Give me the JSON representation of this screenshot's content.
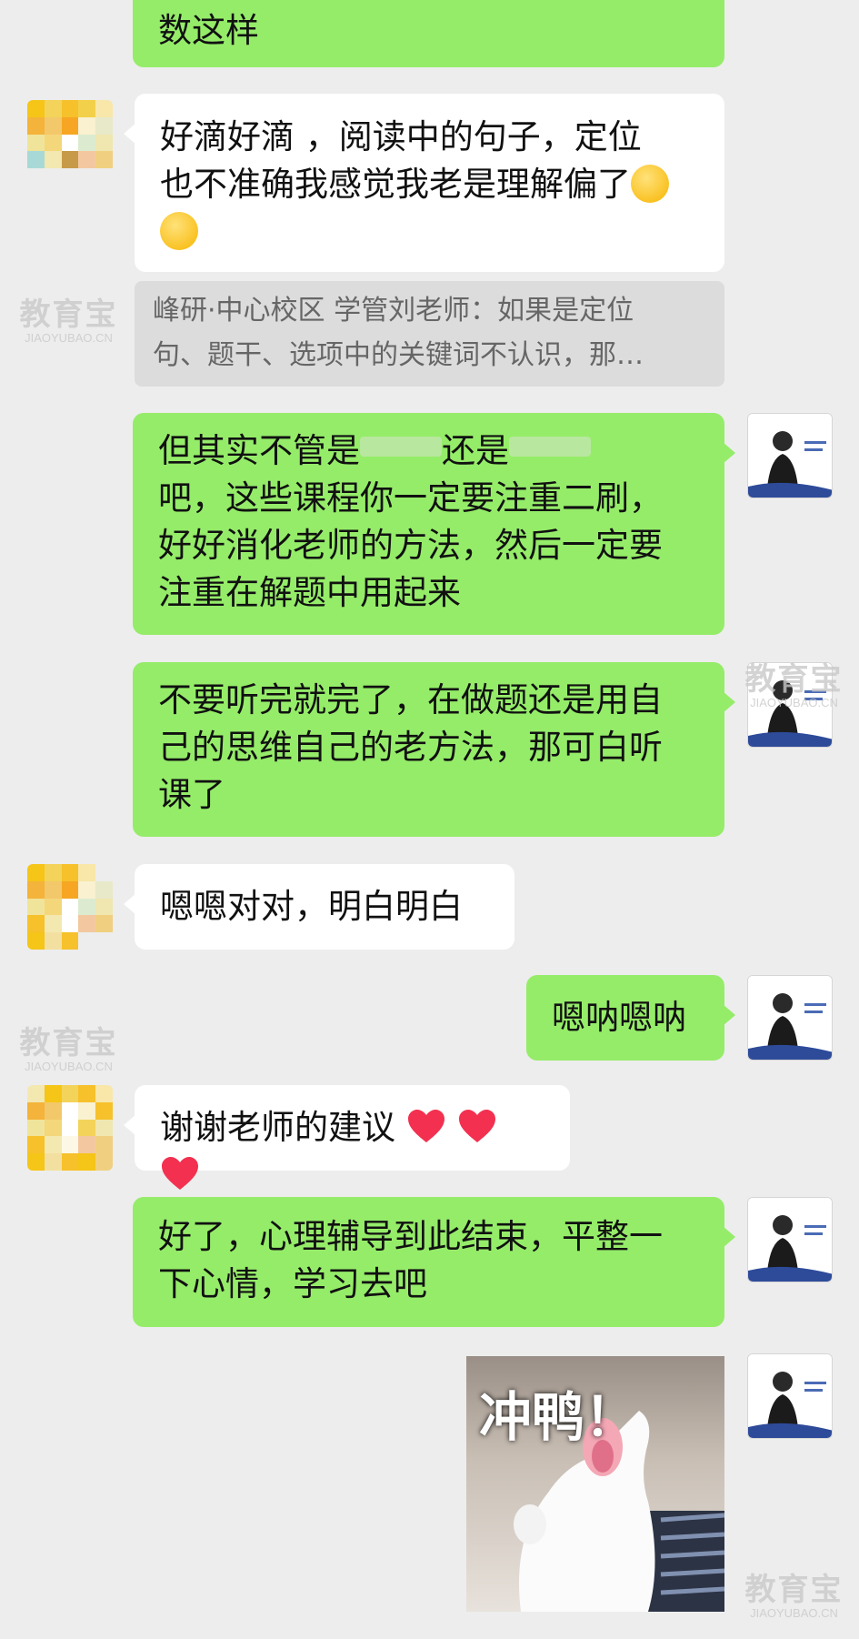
{
  "messages": {
    "m0": "数这样",
    "m1_line1": "好滴好滴 ，阅读中的句子，定位",
    "m1_line2": "也不准确我感觉我老是理解偏了",
    "quote_line1": "峰研·中心校区 学管刘老师：如果是定位",
    "quote_line2": "句、题干、选项中的关键词不认识，那…",
    "m2_a": "但其实不管是",
    "m2_b": "还是",
    "m2_line2": "吧，这些课程你一定要注重二刷，",
    "m2_line3": "好好消化老师的方法，然后一定要",
    "m2_line4": "注重在解题中用起来",
    "m3_line1": "不要听完就完了，在做题还是用自",
    "m3_line2": "己的思维自己的老方法，那可白听",
    "m3_line3": "课了",
    "m4": "嗯嗯对对，明白明白",
    "m5": "嗯呐嗯呐",
    "m6": "谢谢老师的建议",
    "m7_line1": "好了，心理辅导到此结束，平整一",
    "m7_line2": "下心情，学习去吧",
    "sticker_text": "冲鸭！"
  },
  "watermark": {
    "big": "教育宝",
    "small": "JIAOYUBAO.CN"
  },
  "colors": {
    "sent_bubble": "#95ec69",
    "recv_bubble": "#ffffff",
    "background": "#ededed"
  },
  "icons": {
    "sad": "pensive-face-emoji",
    "heart": "red-heart-emoji"
  }
}
